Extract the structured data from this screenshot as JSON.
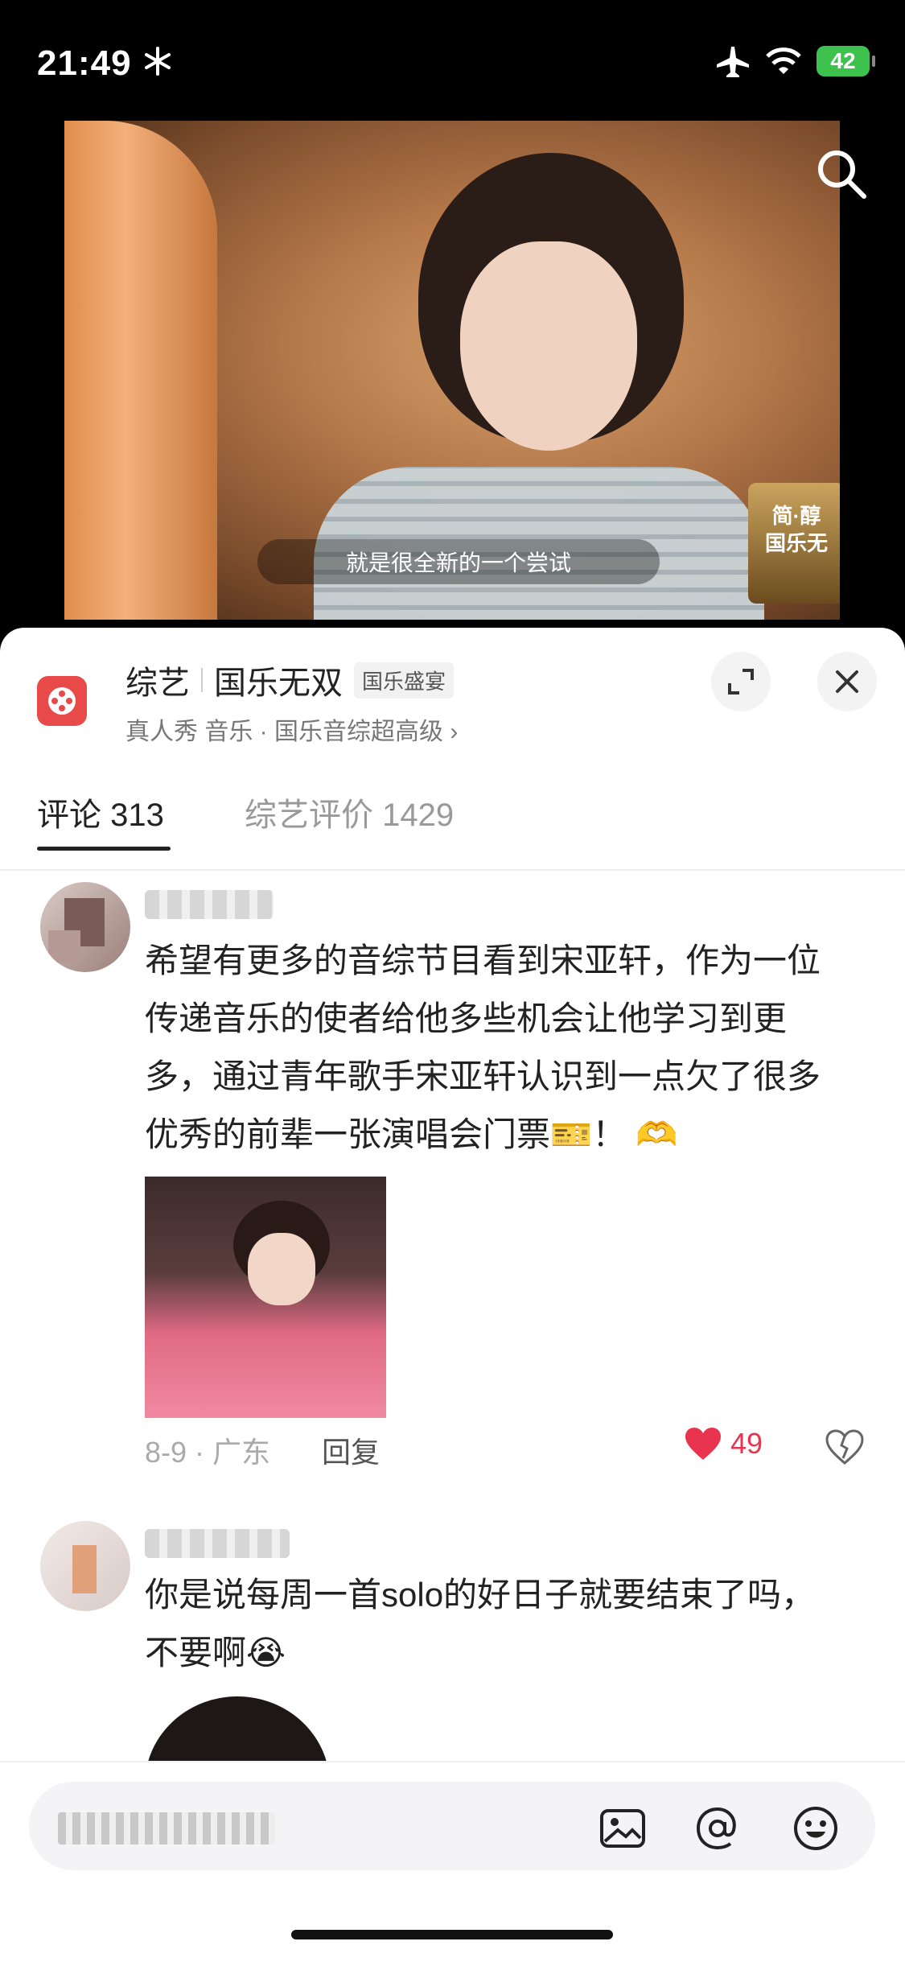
{
  "status": {
    "time": "21:49",
    "battery": "42"
  },
  "video": {
    "subtitle": "就是很全新的一个尝试",
    "badge_line1": "简·醇",
    "badge_line2": "国乐无"
  },
  "show": {
    "category": "综艺",
    "title": "国乐无双",
    "tag": "国乐盛宴",
    "subtitle": "真人秀 音乐 · 国乐音综超高级 ›"
  },
  "tabs": {
    "comments": "评论 313",
    "reviews": "综艺评价 1429"
  },
  "comments": [
    {
      "text_lines": [
        "希望有更多的音综节目看到宋亚轩，作为一位",
        "传递音乐的使者给他多些机会让他学习到更",
        "多，通过青年歌手宋亚轩认识到一点欠了很多",
        "优秀的前辈一张演唱会门票🎫！ 🫶"
      ],
      "meta": "8-9 · 广东",
      "reply": "回复",
      "likes": "49"
    },
    {
      "text_lines": [
        "你是说每周一首solo的好日子就要结束了吗，",
        "不要啊😭"
      ]
    }
  ],
  "icons": [
    "snowflake-icon",
    "airplane-icon",
    "wifi-icon",
    "battery-icon",
    "search-icon",
    "expand-icon",
    "close-icon",
    "heart-icon",
    "broken-heart-icon",
    "image-icon",
    "at-icon",
    "emoji-icon"
  ]
}
